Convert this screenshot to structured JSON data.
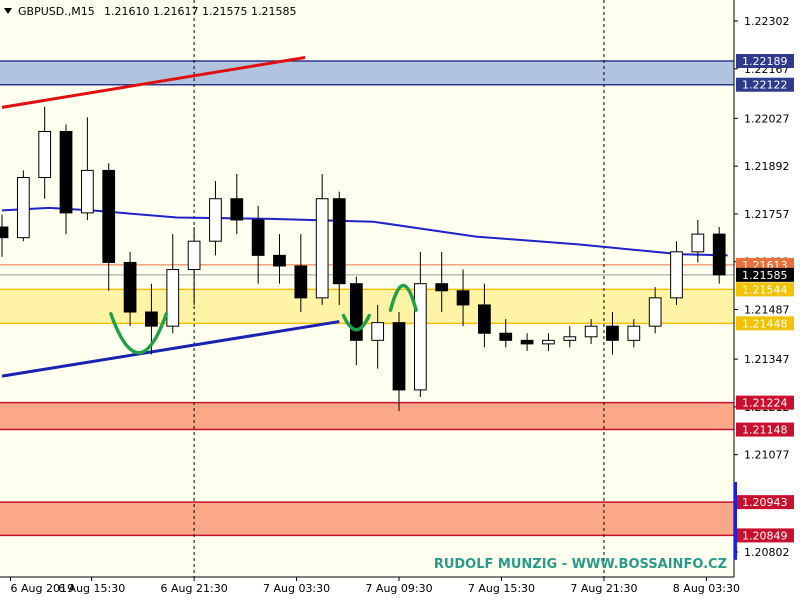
{
  "header": {
    "symbol": "GBPUSD.,M15",
    "ohlc": "1.21610 1.21617 1.21575 1.21585"
  },
  "watermark": "RUDOLF MUNZIG - WWW.BOSSAINFO.CZ",
  "colors": {
    "background": "#FFFFF0",
    "candle": "#000000",
    "ma": "#1E22C8",
    "upper_trend": "#E01010",
    "lower_trend": "#1A22B0",
    "resistance_zone": "#B0C4E0",
    "support_zone": "#FFF3A6",
    "demand_zone": "#FBA888",
    "pattern": "#22A046",
    "current_price": "#000000"
  },
  "chart_data": {
    "type": "candlestick",
    "symbol": "GBPUSD.",
    "timeframe": "M15",
    "ylim": [
      1.2074,
      1.2235
    ],
    "y_ticks": [
      1.22302,
      1.22167,
      1.22027,
      1.21892,
      1.21757,
      1.21622,
      1.21487,
      1.21347,
      1.21212,
      1.21077,
      1.20942,
      1.20802
    ],
    "x_range": [
      "2019-08-06 10:15",
      "2019-08-08 05:00"
    ],
    "x_ticks": [
      {
        "label": "6 Aug 2019",
        "time": "2019-08-06 10:45"
      },
      {
        "label": "6 Aug 15:30",
        "time": "2019-08-06 15:30"
      },
      {
        "label": "6 Aug 21:30",
        "time": "2019-08-06 21:30"
      },
      {
        "label": "7 Aug 03:30",
        "time": "2019-08-07 03:30"
      },
      {
        "label": "7 Aug 09:30",
        "time": "2019-08-07 09:30"
      },
      {
        "label": "7 Aug 15:30",
        "time": "2019-08-07 15:30"
      },
      {
        "label": "7 Aug 21:30",
        "time": "2019-08-07 21:30"
      },
      {
        "label": "8 Aug 03:30",
        "time": "2019-08-08 03:30"
      }
    ],
    "period_separators": [
      "2019-08-06 21:30",
      "2019-08-07 21:30"
    ],
    "current_price": 1.21585,
    "price_labels": [
      {
        "value": 1.22189,
        "label": "1.22189",
        "color": "#2E3A8C",
        "text_color": "#FFFFFF"
      },
      {
        "value": 1.22122,
        "label": "1.22122",
        "color": "#2E3A8C",
        "text_color": "#FFFFFF"
      },
      {
        "value": 1.21613,
        "label": "1.21613",
        "color": "#E8703A",
        "text_color": "#FFFFFF"
      },
      {
        "value": 1.21585,
        "label": "1.21585",
        "color": "#000000",
        "text_color": "#FFFFFF"
      },
      {
        "value": 1.21544,
        "label": "1.21544",
        "color": "#F2C200",
        "text_color": "#FFFFFF"
      },
      {
        "value": 1.21448,
        "label": "1.21448",
        "color": "#F2C200",
        "text_color": "#FFFFFF"
      },
      {
        "value": 1.21224,
        "label": "1.21224",
        "color": "#C8102E",
        "text_color": "#FFFFFF"
      },
      {
        "value": 1.21148,
        "label": "1.21148",
        "color": "#C8102E",
        "text_color": "#FFFFFF"
      },
      {
        "value": 1.20943,
        "label": "1.20943",
        "color": "#C8102E",
        "text_color": "#FFFFFF"
      },
      {
        "value": 1.20849,
        "label": "1.20849",
        "color": "#C8102E",
        "text_color": "#FFFFFF"
      }
    ],
    "zones": [
      {
        "name": "resistance",
        "from": 1.22122,
        "to": 1.22189,
        "color": "#B0C4E0",
        "edge": "#2E3A8C"
      },
      {
        "name": "support",
        "from": 1.21448,
        "to": 1.21544,
        "color": "#FFF3A6",
        "edge": "#F2C200"
      },
      {
        "name": "demand-upper",
        "from": 1.21148,
        "to": 1.21224,
        "color": "#FBA888",
        "edge": "#C8102E"
      },
      {
        "name": "demand-lower",
        "from": 1.20849,
        "to": 1.20943,
        "color": "#FBA888",
        "edge": "#C8102E"
      }
    ],
    "trendlines": [
      {
        "name": "upper-trend",
        "color": "#E01010",
        "points": [
          [
            "2019-08-06 10:15",
            1.22058
          ],
          [
            "2019-08-07 04:00",
            1.22199
          ]
        ]
      },
      {
        "name": "lower-trend",
        "color": "#1A22B0",
        "points": [
          [
            "2019-08-06 10:15",
            1.21299
          ],
          [
            "2019-08-07 06:00",
            1.21453
          ]
        ]
      }
    ],
    "moving_average": {
      "color": "#1E22C8",
      "points": [
        [
          "2019-08-06 10:15",
          1.21767
        ],
        [
          "2019-08-06 13:00",
          1.21774
        ],
        [
          "2019-08-06 15:30",
          1.21767
        ],
        [
          "2019-08-06 20:30",
          1.21747
        ],
        [
          "2019-08-07 02:00",
          1.21743
        ],
        [
          "2019-08-07 08:00",
          1.21735
        ],
        [
          "2019-08-07 14:00",
          1.21693
        ],
        [
          "2019-08-07 20:00",
          1.21671
        ],
        [
          "2019-08-08 02:00",
          1.21643
        ],
        [
          "2019-08-08 04:45",
          1.2164
        ]
      ]
    },
    "ohlc": [
      [
        "2019-08-06 10:15",
        1.2172,
        1.21755,
        1.21636,
        1.2169
      ],
      [
        "2019-08-06 11:30",
        1.2169,
        1.2188,
        1.2168,
        1.2186
      ],
      [
        "2019-08-06 12:45",
        1.2186,
        1.2206,
        1.218,
        1.2199
      ],
      [
        "2019-08-06 14:00",
        1.2199,
        1.2201,
        1.217,
        1.2176
      ],
      [
        "2019-08-06 15:15",
        1.2176,
        1.2203,
        1.2174,
        1.2188
      ],
      [
        "2019-08-06 16:30",
        1.2188,
        1.219,
        1.2154,
        1.2162
      ],
      [
        "2019-08-06 17:45",
        1.2162,
        1.2165,
        1.2144,
        1.2148
      ],
      [
        "2019-08-06 19:00",
        1.2148,
        1.2156,
        1.2136,
        1.2144
      ],
      [
        "2019-08-06 20:15",
        1.2144,
        1.217,
        1.2142,
        1.216
      ],
      [
        "2019-08-06 21:30",
        1.216,
        1.2172,
        1.215,
        1.2168
      ],
      [
        "2019-08-06 22:45",
        1.2168,
        1.2185,
        1.2164,
        1.218
      ],
      [
        "2019-08-07 00:00",
        1.218,
        1.2187,
        1.217,
        1.2174
      ],
      [
        "2019-08-07 01:15",
        1.2174,
        1.2178,
        1.2156,
        1.2164
      ],
      [
        "2019-08-07 02:30",
        1.2164,
        1.217,
        1.2156,
        1.2161
      ],
      [
        "2019-08-07 03:45",
        1.2161,
        1.217,
        1.2148,
        1.2152
      ],
      [
        "2019-08-07 05:00",
        1.2152,
        1.2187,
        1.215,
        1.218
      ],
      [
        "2019-08-07 06:00",
        1.218,
        1.2182,
        1.215,
        1.2156
      ],
      [
        "2019-08-07 07:00",
        1.2156,
        1.2158,
        1.2133,
        1.214
      ],
      [
        "2019-08-07 08:15",
        1.214,
        1.215,
        1.2132,
        1.2145
      ],
      [
        "2019-08-07 09:30",
        1.2145,
        1.2148,
        1.212,
        1.2126
      ],
      [
        "2019-08-07 10:45",
        1.2126,
        1.2165,
        1.2124,
        1.2156
      ],
      [
        "2019-08-07 12:00",
        1.2156,
        1.2165,
        1.2148,
        1.2154
      ],
      [
        "2019-08-07 13:15",
        1.2154,
        1.216,
        1.2144,
        1.215
      ],
      [
        "2019-08-07 14:30",
        1.215,
        1.2156,
        1.2138,
        1.2142
      ],
      [
        "2019-08-07 15:45",
        1.2142,
        1.2146,
        1.2138,
        1.214
      ],
      [
        "2019-08-07 17:00",
        1.214,
        1.2142,
        1.2137,
        1.2139
      ],
      [
        "2019-08-07 18:15",
        1.2139,
        1.2142,
        1.2137,
        1.214
      ],
      [
        "2019-08-07 19:30",
        1.214,
        1.2144,
        1.2138,
        1.2141
      ],
      [
        "2019-08-07 20:45",
        1.2141,
        1.2146,
        1.2139,
        1.2144
      ],
      [
        "2019-08-07 22:00",
        1.2144,
        1.2148,
        1.2136,
        1.214
      ],
      [
        "2019-08-07 23:15",
        1.214,
        1.2146,
        1.2138,
        1.2144
      ],
      [
        "2019-08-08 00:30",
        1.2144,
        1.2155,
        1.2142,
        1.2152
      ],
      [
        "2019-08-08 01:45",
        1.2152,
        1.2168,
        1.215,
        1.2165
      ],
      [
        "2019-08-08 03:00",
        1.2165,
        1.2174,
        1.2162,
        1.217
      ],
      [
        "2019-08-08 04:15",
        1.217,
        1.2172,
        1.2156,
        1.21585
      ]
    ],
    "annotations": [
      {
        "name": "rounding-bottom-arc",
        "type": "arc-up",
        "color": "#22A046",
        "center": [
          "2019-08-06 18:15",
          1.2142
        ],
        "span_hours": 3.25,
        "depth": 0.0011
      },
      {
        "name": "small-bottom-arc",
        "type": "arc-up",
        "color": "#22A046",
        "center": [
          "2019-08-07 07:00",
          1.2145
        ],
        "span_hours": 1.5,
        "depth": 0.0004
      },
      {
        "name": "small-top-arc",
        "type": "arc-down",
        "color": "#22A046",
        "center": [
          "2019-08-07 09:45",
          1.2152
        ],
        "span_hours": 1.5,
        "depth": 0.0007
      }
    ]
  }
}
